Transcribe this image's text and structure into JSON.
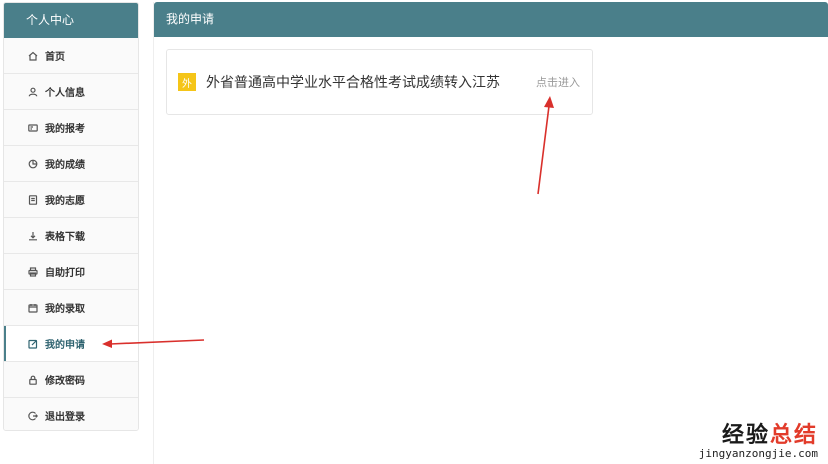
{
  "sidebar": {
    "title": "个人中心",
    "items": [
      {
        "label": "首页",
        "icon": "home-icon"
      },
      {
        "label": "个人信息",
        "icon": "user-icon"
      },
      {
        "label": "我的报考",
        "icon": "id-card-icon"
      },
      {
        "label": "我的成绩",
        "icon": "pie-chart-icon"
      },
      {
        "label": "我的志愿",
        "icon": "document-icon"
      },
      {
        "label": "表格下载",
        "icon": "download-icon"
      },
      {
        "label": "自助打印",
        "icon": "printer-icon"
      },
      {
        "label": "我的录取",
        "icon": "calendar-icon"
      },
      {
        "label": "我的申请",
        "icon": "edit-icon",
        "active": true
      },
      {
        "label": "修改密码",
        "icon": "lock-icon"
      },
      {
        "label": "退出登录",
        "icon": "logout-icon"
      }
    ]
  },
  "main": {
    "title": "我的申请",
    "card": {
      "badge": "外",
      "title": "外省普通高中学业水平合格性考试成绩转入江苏",
      "link": "点击进入"
    }
  },
  "watermark": {
    "text_main": "经验",
    "text_accent": "总结",
    "url": "jingyanzongjie.com"
  },
  "colors": {
    "header": "#4a7f8a",
    "badge": "#f5c518",
    "annotation_arrow": "#d9302c"
  }
}
